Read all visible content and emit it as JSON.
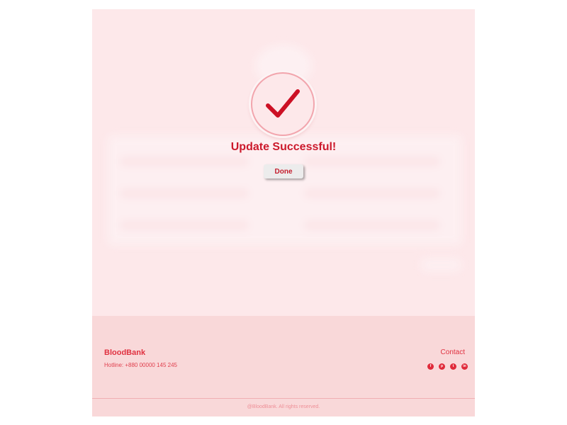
{
  "modal": {
    "title": "Update Successful!",
    "done_label": "Done",
    "check_icon": "check-icon",
    "accent": "#cc1a2c"
  },
  "footer": {
    "brand": "BloodBank",
    "hotline": "Hotline: +880 00000 145 245",
    "contact_label": "Contact",
    "social_icons": [
      "facebook-icon",
      "pinterest-icon",
      "twitter-icon",
      "linkedin-icon"
    ],
    "social_glyphs": [
      "f",
      "p",
      "t",
      "in"
    ],
    "copyright": "@BloodBank. All rights reserved."
  },
  "colors": {
    "page_bg": "#fde8ea",
    "footer_bg": "#f9d8d9",
    "brand_red": "#e03140"
  }
}
